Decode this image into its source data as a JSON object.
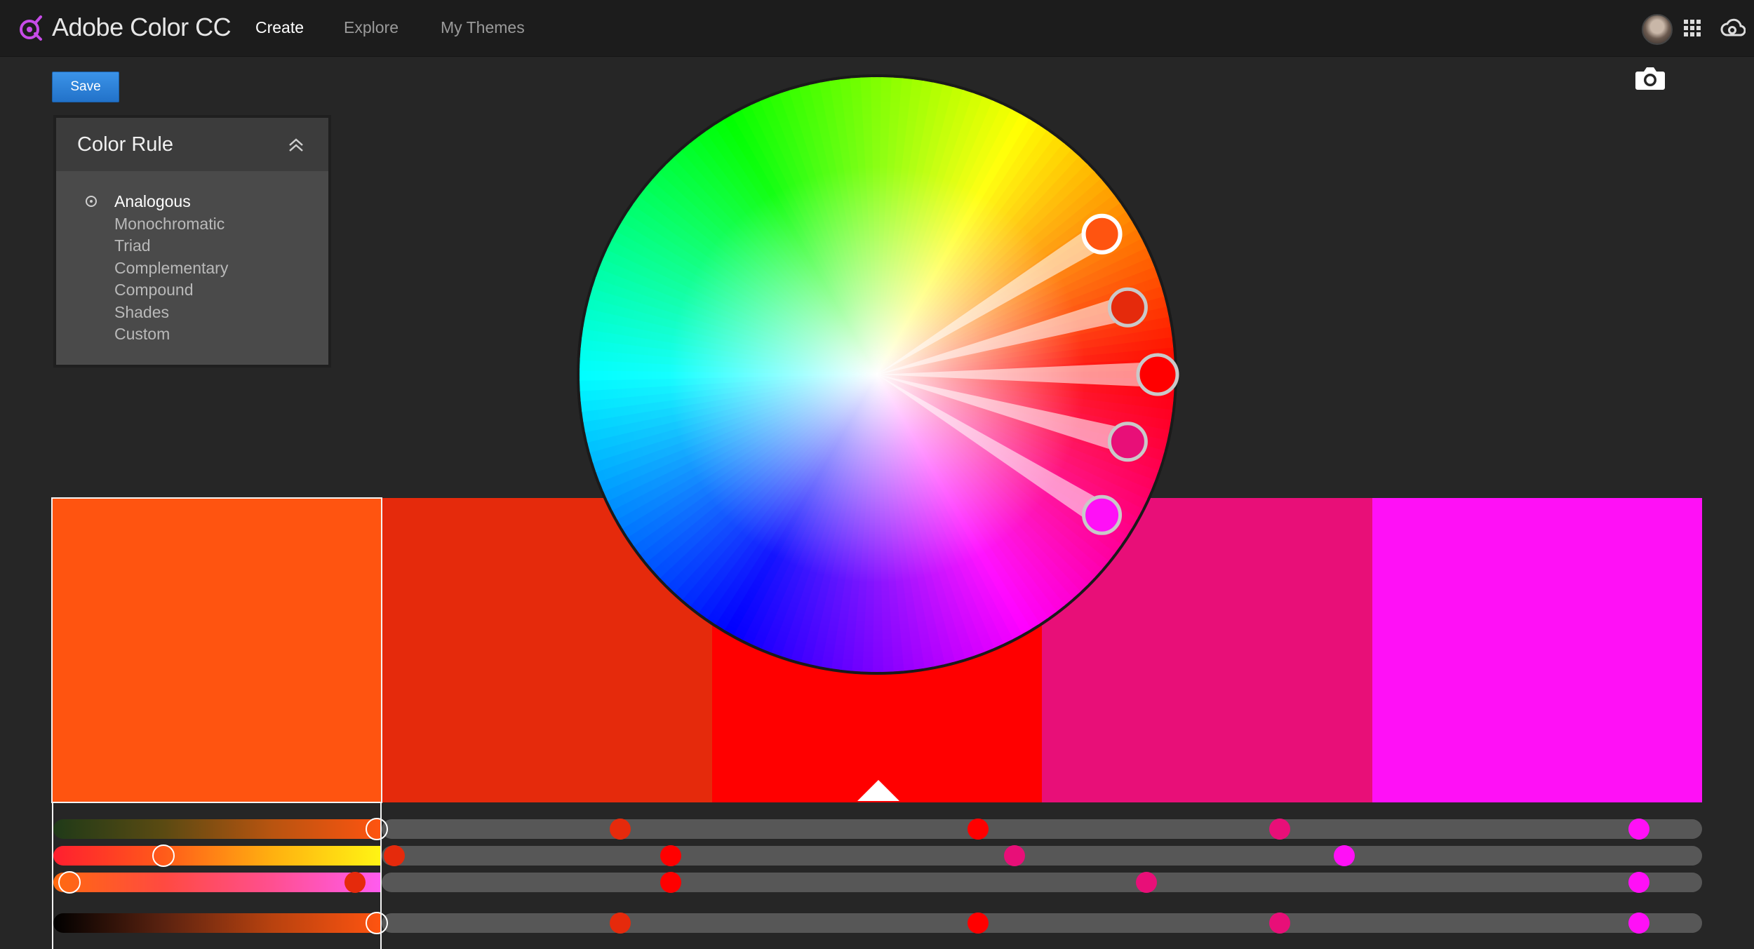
{
  "app": {
    "title": "Adobe Color CC"
  },
  "nav": {
    "create": "Create",
    "explore": "Explore",
    "my_themes": "My Themes"
  },
  "toolbar": {
    "save_label": "Save"
  },
  "color_rule": {
    "title": "Color Rule",
    "options": [
      "Analogous",
      "Monochromatic",
      "Triad",
      "Complementary",
      "Compound",
      "Shades",
      "Custom"
    ],
    "selected": "Analogous"
  },
  "theme": {
    "swatches": [
      "#ff5410",
      "#e52a0c",
      "#ff0000",
      "#e80f78",
      "#ff10f6"
    ],
    "selected_index": 0,
    "base_index": 2
  },
  "icons": {
    "logo": "adobe-color-logo-icon",
    "apps": "apps-grid-icon",
    "creative_cloud": "creative-cloud-icon",
    "camera": "camera-icon",
    "collapse": "double-chevron-up-icon",
    "radio": "radio-selected-icon"
  },
  "colors": {
    "accent": "#2f86dc",
    "background": "#262626",
    "topbar": "#1c1c1c"
  }
}
